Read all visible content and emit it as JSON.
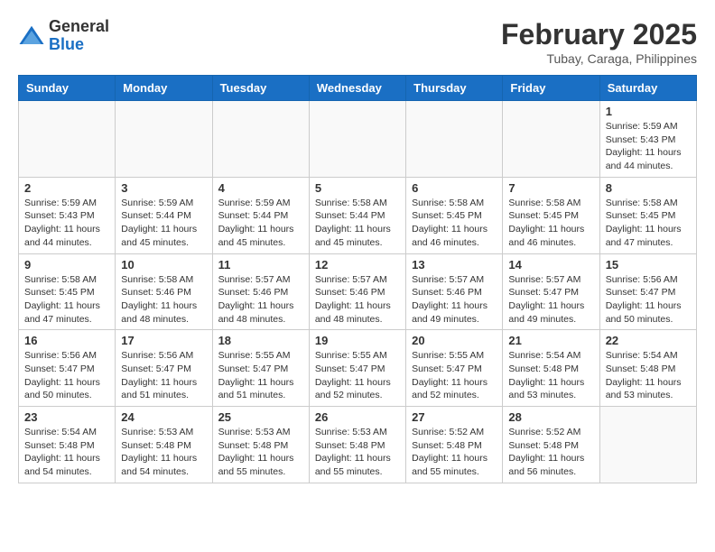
{
  "header": {
    "logo_general": "General",
    "logo_blue": "Blue",
    "month_year": "February 2025",
    "location": "Tubay, Caraga, Philippines"
  },
  "weekdays": [
    "Sunday",
    "Monday",
    "Tuesday",
    "Wednesday",
    "Thursday",
    "Friday",
    "Saturday"
  ],
  "weeks": [
    [
      {
        "day": "",
        "info": ""
      },
      {
        "day": "",
        "info": ""
      },
      {
        "day": "",
        "info": ""
      },
      {
        "day": "",
        "info": ""
      },
      {
        "day": "",
        "info": ""
      },
      {
        "day": "",
        "info": ""
      },
      {
        "day": "1",
        "info": "Sunrise: 5:59 AM\nSunset: 5:43 PM\nDaylight: 11 hours\nand 44 minutes."
      }
    ],
    [
      {
        "day": "2",
        "info": "Sunrise: 5:59 AM\nSunset: 5:43 PM\nDaylight: 11 hours\nand 44 minutes."
      },
      {
        "day": "3",
        "info": "Sunrise: 5:59 AM\nSunset: 5:44 PM\nDaylight: 11 hours\nand 45 minutes."
      },
      {
        "day": "4",
        "info": "Sunrise: 5:59 AM\nSunset: 5:44 PM\nDaylight: 11 hours\nand 45 minutes."
      },
      {
        "day": "5",
        "info": "Sunrise: 5:58 AM\nSunset: 5:44 PM\nDaylight: 11 hours\nand 45 minutes."
      },
      {
        "day": "6",
        "info": "Sunrise: 5:58 AM\nSunset: 5:45 PM\nDaylight: 11 hours\nand 46 minutes."
      },
      {
        "day": "7",
        "info": "Sunrise: 5:58 AM\nSunset: 5:45 PM\nDaylight: 11 hours\nand 46 minutes."
      },
      {
        "day": "8",
        "info": "Sunrise: 5:58 AM\nSunset: 5:45 PM\nDaylight: 11 hours\nand 47 minutes."
      }
    ],
    [
      {
        "day": "9",
        "info": "Sunrise: 5:58 AM\nSunset: 5:45 PM\nDaylight: 11 hours\nand 47 minutes."
      },
      {
        "day": "10",
        "info": "Sunrise: 5:58 AM\nSunset: 5:46 PM\nDaylight: 11 hours\nand 48 minutes."
      },
      {
        "day": "11",
        "info": "Sunrise: 5:57 AM\nSunset: 5:46 PM\nDaylight: 11 hours\nand 48 minutes."
      },
      {
        "day": "12",
        "info": "Sunrise: 5:57 AM\nSunset: 5:46 PM\nDaylight: 11 hours\nand 48 minutes."
      },
      {
        "day": "13",
        "info": "Sunrise: 5:57 AM\nSunset: 5:46 PM\nDaylight: 11 hours\nand 49 minutes."
      },
      {
        "day": "14",
        "info": "Sunrise: 5:57 AM\nSunset: 5:47 PM\nDaylight: 11 hours\nand 49 minutes."
      },
      {
        "day": "15",
        "info": "Sunrise: 5:56 AM\nSunset: 5:47 PM\nDaylight: 11 hours\nand 50 minutes."
      }
    ],
    [
      {
        "day": "16",
        "info": "Sunrise: 5:56 AM\nSunset: 5:47 PM\nDaylight: 11 hours\nand 50 minutes."
      },
      {
        "day": "17",
        "info": "Sunrise: 5:56 AM\nSunset: 5:47 PM\nDaylight: 11 hours\nand 51 minutes."
      },
      {
        "day": "18",
        "info": "Sunrise: 5:55 AM\nSunset: 5:47 PM\nDaylight: 11 hours\nand 51 minutes."
      },
      {
        "day": "19",
        "info": "Sunrise: 5:55 AM\nSunset: 5:47 PM\nDaylight: 11 hours\nand 52 minutes."
      },
      {
        "day": "20",
        "info": "Sunrise: 5:55 AM\nSunset: 5:47 PM\nDaylight: 11 hours\nand 52 minutes."
      },
      {
        "day": "21",
        "info": "Sunrise: 5:54 AM\nSunset: 5:48 PM\nDaylight: 11 hours\nand 53 minutes."
      },
      {
        "day": "22",
        "info": "Sunrise: 5:54 AM\nSunset: 5:48 PM\nDaylight: 11 hours\nand 53 minutes."
      }
    ],
    [
      {
        "day": "23",
        "info": "Sunrise: 5:54 AM\nSunset: 5:48 PM\nDaylight: 11 hours\nand 54 minutes."
      },
      {
        "day": "24",
        "info": "Sunrise: 5:53 AM\nSunset: 5:48 PM\nDaylight: 11 hours\nand 54 minutes."
      },
      {
        "day": "25",
        "info": "Sunrise: 5:53 AM\nSunset: 5:48 PM\nDaylight: 11 hours\nand 55 minutes."
      },
      {
        "day": "26",
        "info": "Sunrise: 5:53 AM\nSunset: 5:48 PM\nDaylight: 11 hours\nand 55 minutes."
      },
      {
        "day": "27",
        "info": "Sunrise: 5:52 AM\nSunset: 5:48 PM\nDaylight: 11 hours\nand 55 minutes."
      },
      {
        "day": "28",
        "info": "Sunrise: 5:52 AM\nSunset: 5:48 PM\nDaylight: 11 hours\nand 56 minutes."
      },
      {
        "day": "",
        "info": ""
      }
    ]
  ]
}
